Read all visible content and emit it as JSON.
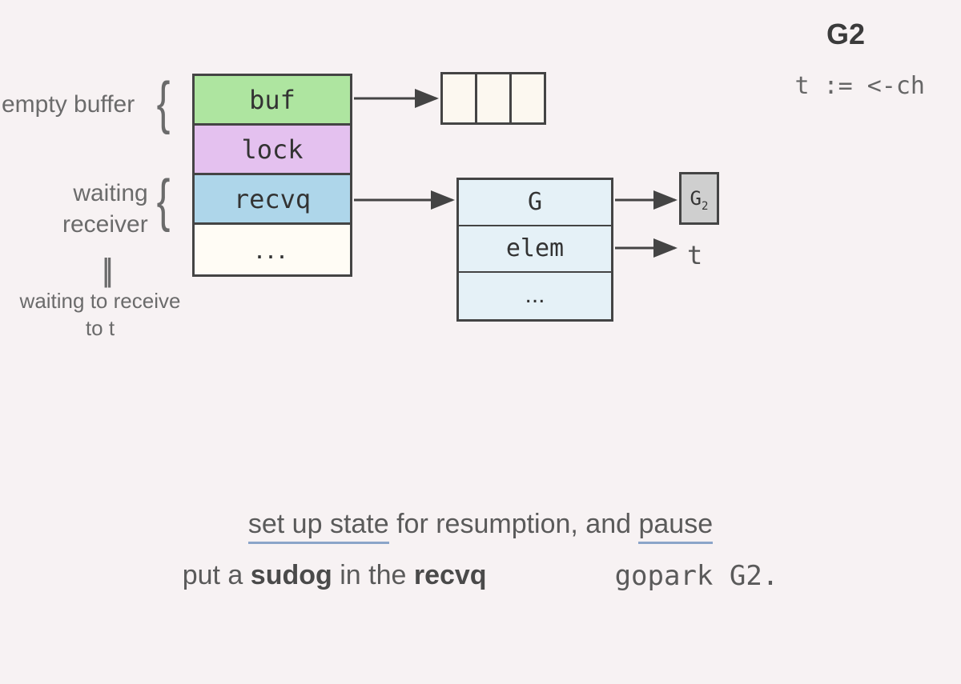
{
  "header": {
    "title": "G2",
    "code": "t := <-ch"
  },
  "labels": {
    "empty_buffer": "empty buffer",
    "waiting_receiver_1": "waiting",
    "waiting_receiver_2": "receiver",
    "waiting_to_receive_1": "waiting to receive",
    "waiting_to_receive_2": "to t"
  },
  "hchan": {
    "buf": "buf",
    "lock": "lock",
    "recvq": "recvq",
    "dots": "..."
  },
  "sudog": {
    "g": "G",
    "elem": "elem",
    "dots": "..."
  },
  "g2box": {
    "G": "G",
    "sub": "2"
  },
  "t": "t",
  "caption": {
    "line1_a": "set up state",
    "line1_b": " for resumption, and ",
    "line1_c": "pause",
    "line2_left_a": "put a ",
    "line2_left_b": "sudog",
    "line2_left_c": " in the ",
    "line2_left_d": "recvq",
    "line2_right": "gopark G2."
  }
}
